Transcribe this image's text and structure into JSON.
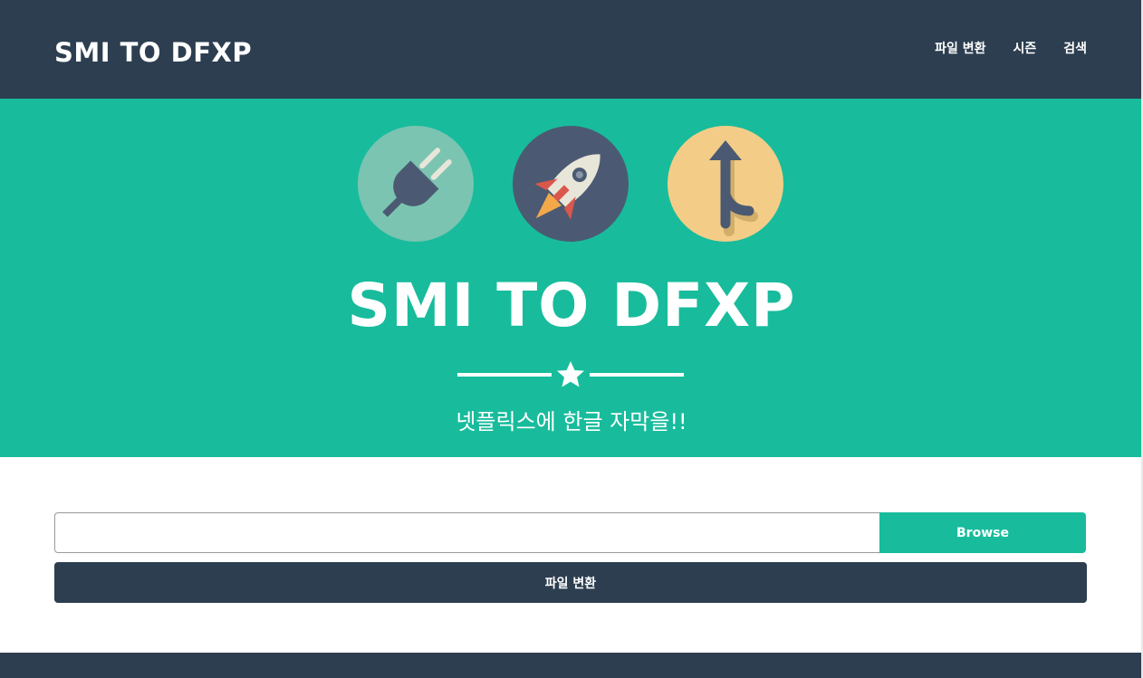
{
  "navbar": {
    "brand": "SMI TO DFXP",
    "links": [
      "파일 변환",
      "시즌",
      "검색"
    ]
  },
  "hero": {
    "icons": [
      "plug-icon",
      "rocket-icon",
      "merge-arrow-icon"
    ],
    "title": "SMI TO DFXP",
    "subtitle": "넷플릭스에 한글 자막을!!"
  },
  "form": {
    "file_value": "",
    "browse_label": "Browse",
    "convert_label": "파일 변환"
  },
  "colors": {
    "navbar": "#2c3e50",
    "hero": "#18bc9c",
    "accent": "#18bc9c"
  }
}
